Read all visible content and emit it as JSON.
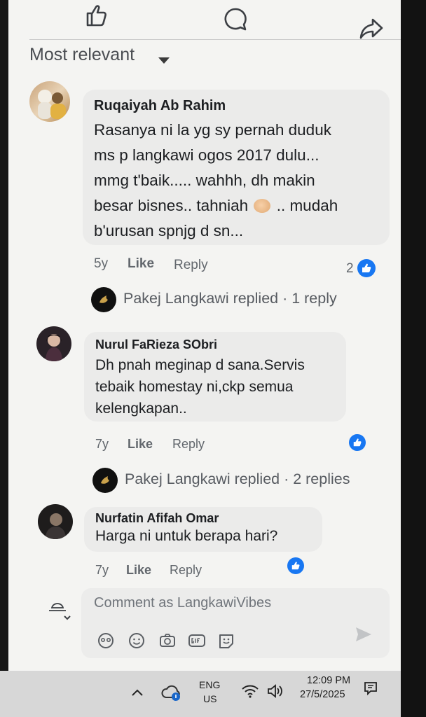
{
  "feed": {
    "sort_label": "Most relevant"
  },
  "comments": [
    {
      "author": "Ruqaiyah Ab Rahim",
      "lines": [
        "Rasanya ni la yg sy pernah duduk",
        "ms p langkawi ogos 2017 dulu...",
        "mmg t'baik..... wahhh, dh makin",
        "besar bisnes.. tahniah",
        ".. mudah",
        "b'urusan spnjg d sn..."
      ],
      "time": "5y",
      "like_label": "Like",
      "reply_label": "Reply",
      "reaction_count": "2",
      "replies_summary": "Pakej Langkawi replied · 1 reply"
    },
    {
      "author": "Nurul FaRieza SObri",
      "lines": [
        "Dh pnah meginap d sana.Servis",
        "tebaik homestay ni,ckp semua",
        "kelengkapan.."
      ],
      "time": "7y",
      "like_label": "Like",
      "reply_label": "Reply",
      "replies_summary": "Pakej Langkawi replied · 2 replies"
    },
    {
      "author": "Nurfatin Afifah Omar",
      "lines": [
        "Harga ni untuk berapa hari?"
      ],
      "time": "7y",
      "like_label": "Like",
      "reply_label": "Reply"
    }
  ],
  "composer": {
    "placeholder": "Comment as LangkawiVibes",
    "icons": [
      "sticker-icon",
      "emoji-icon",
      "camera-icon",
      "gif-icon",
      "avatar-sticker-icon",
      "send-icon"
    ]
  },
  "taskbar": {
    "language": "ENG",
    "region": "US",
    "time": "12:09 PM",
    "date": "27/5/2025"
  },
  "colors": {
    "like_blue": "#1877f2",
    "text": "#1c1e21",
    "muted": "#62676d"
  }
}
